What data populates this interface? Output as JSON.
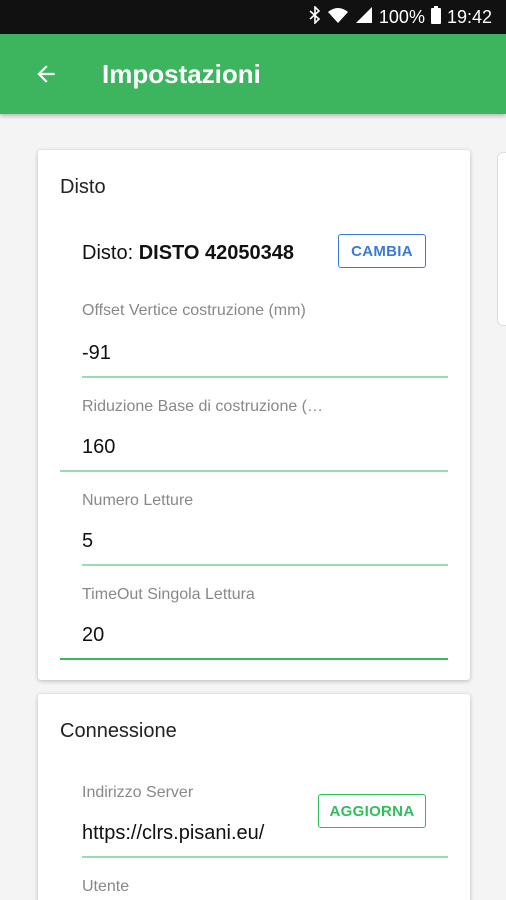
{
  "status_bar": {
    "icons": [
      "bluetooth-icon",
      "wifi-icon",
      "signal-icon"
    ],
    "battery": "100%",
    "time": "19:42"
  },
  "app_bar": {
    "title": "Impostazioni",
    "back_icon": "arrow-left-icon",
    "color": "#3cb55e"
  },
  "disto_card": {
    "title": "Disto",
    "device_label": "Disto:",
    "device_name": "DISTO 42050348",
    "change_button": "CAMBIA",
    "fields": [
      {
        "label": "Offset Vertice costruzione (mm)",
        "value": "-91"
      },
      {
        "label": "Riduzione Base di costruzione (…",
        "value": "160"
      },
      {
        "label": "Numero Letture",
        "value": "5"
      },
      {
        "label": "TimeOut Singola Lettura",
        "value": "20"
      }
    ]
  },
  "connection_card": {
    "title": "Connessione",
    "server_label": "Indirizzo Server",
    "server_value": "https://clrs.pisani.eu/",
    "update_button": "AGGIORNA",
    "user_label": "Utente"
  }
}
